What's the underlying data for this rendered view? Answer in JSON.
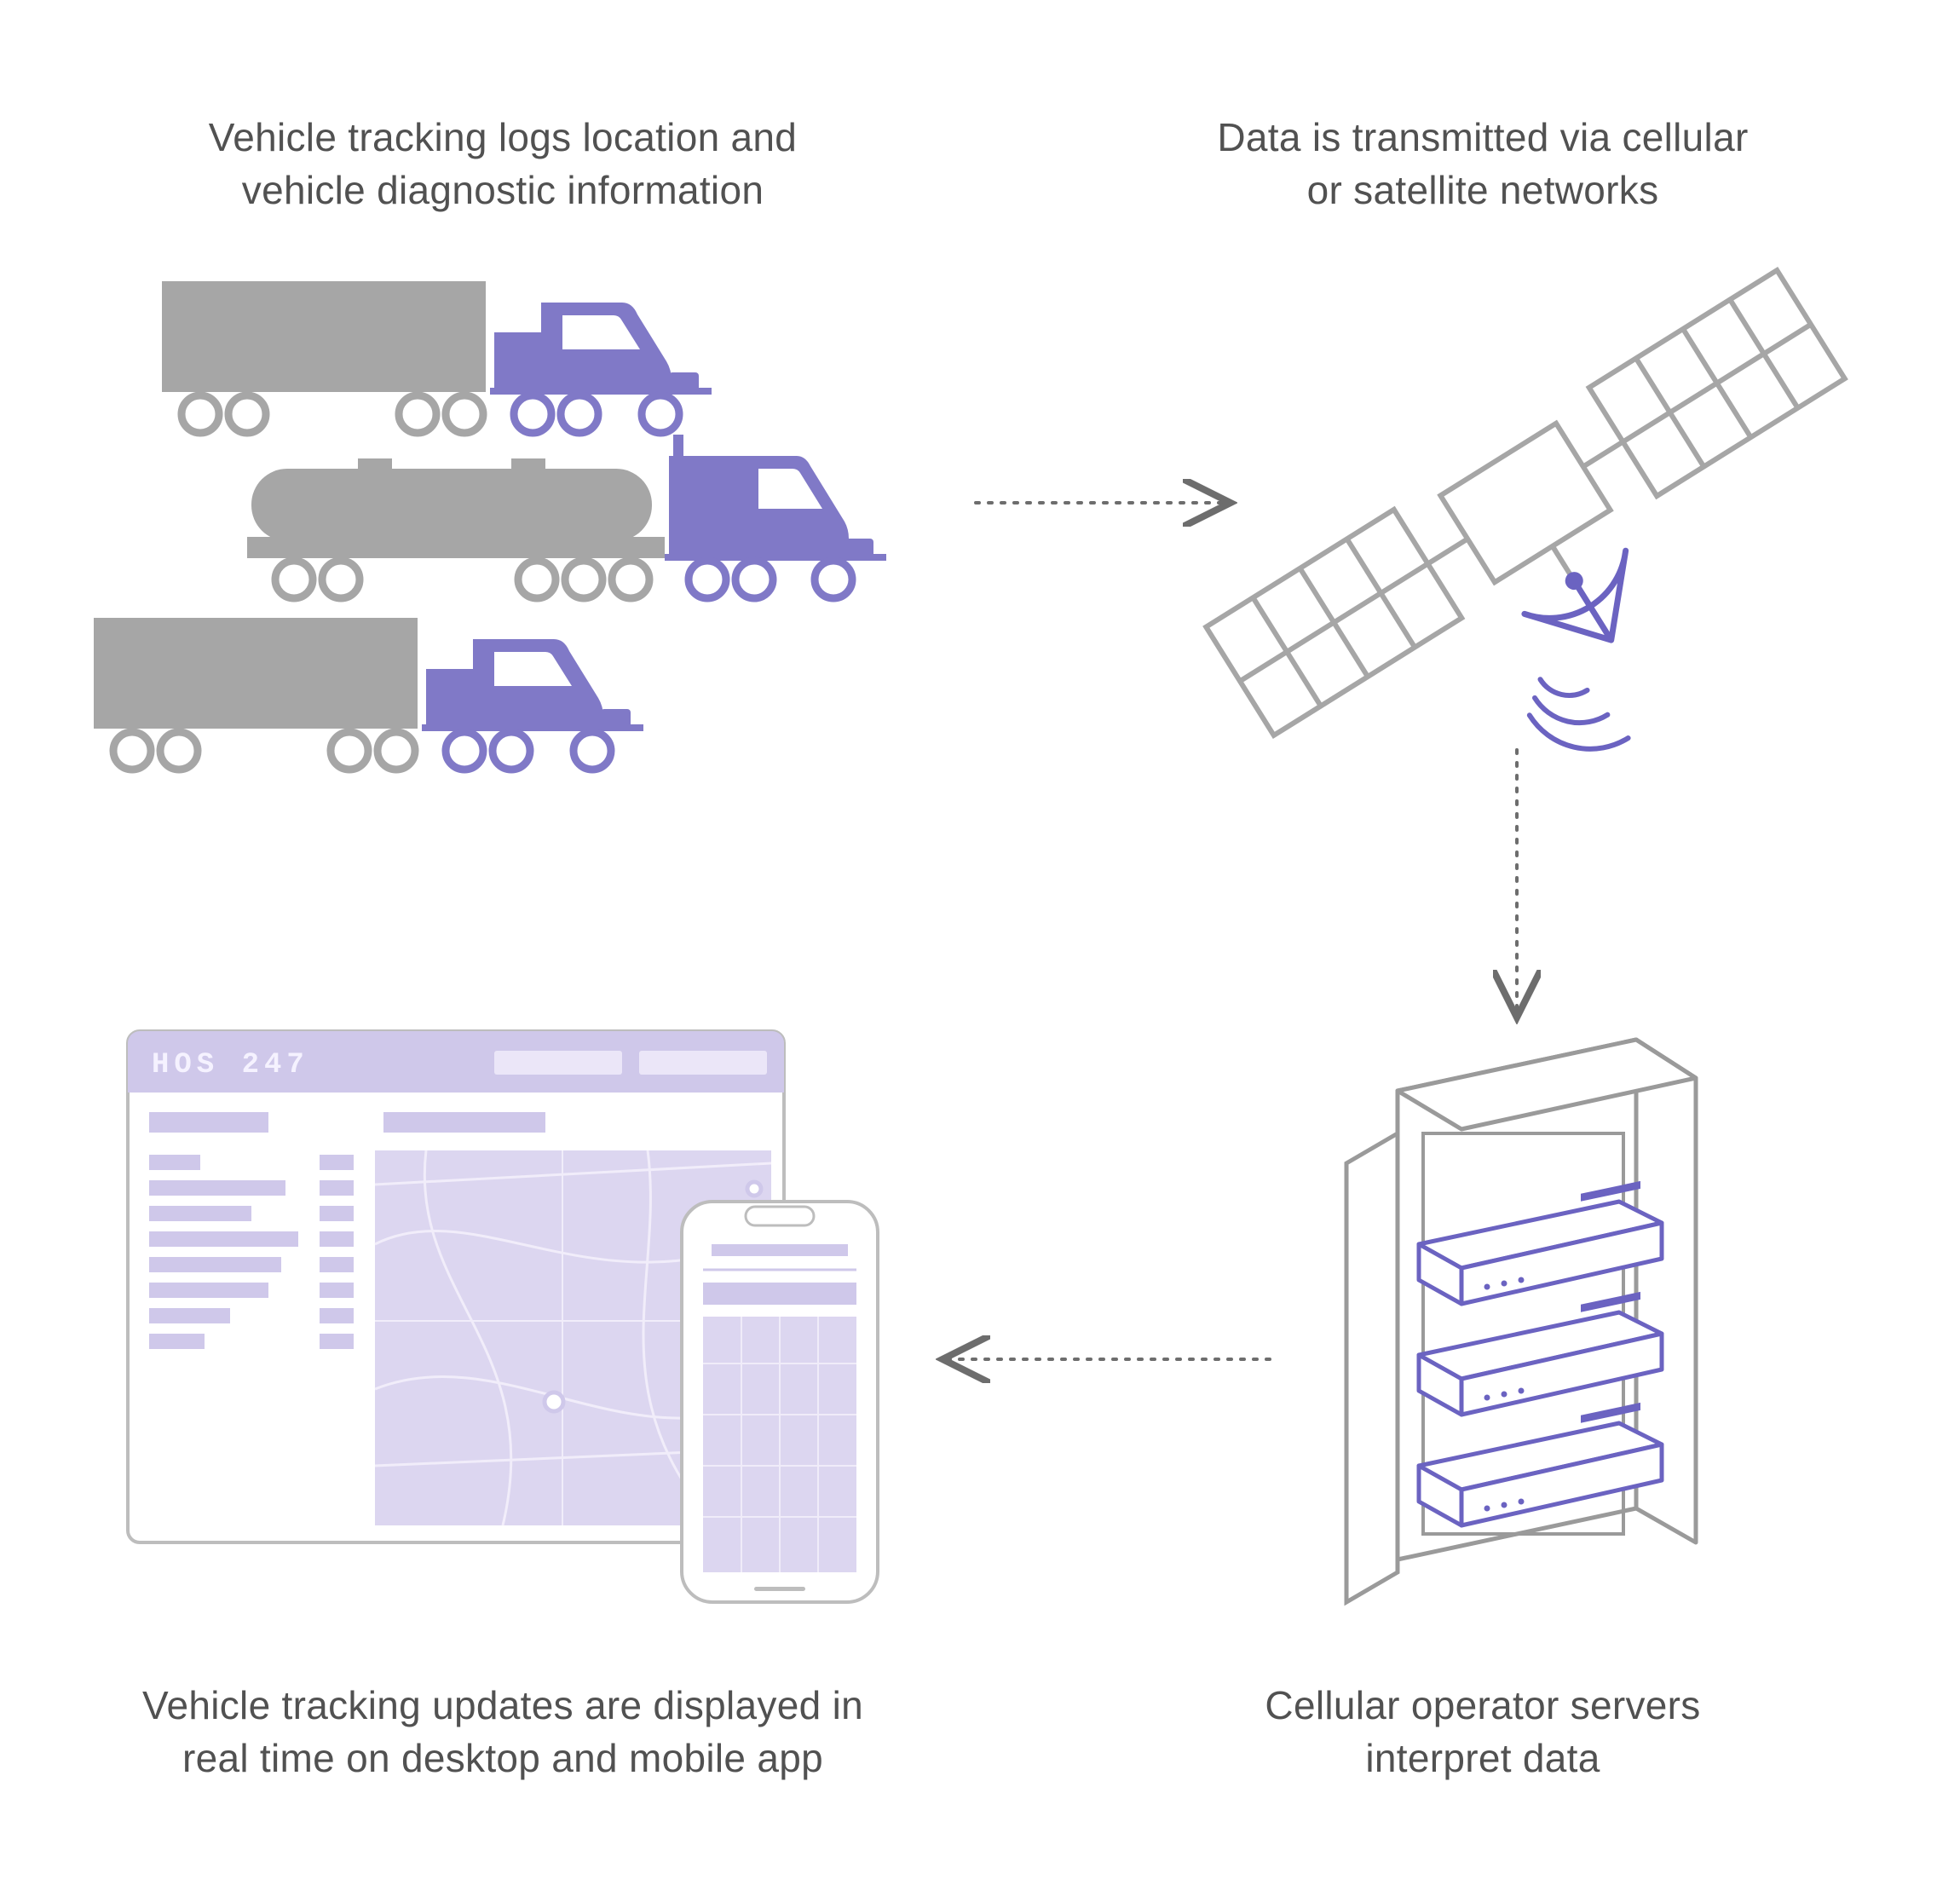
{
  "captions": {
    "vehicles": "Vehicle tracking logs location and\nvehicle diagnostic information",
    "satellite": "Data is transmitted via cellular\nor satellite networks",
    "server": "Cellular operator servers\ninterpret data",
    "dashboard": "Vehicle tracking updates are displayed in\nreal time on desktop and mobile app"
  },
  "dashboard": {
    "brand": "HOS 247"
  },
  "colors": {
    "purple": "#8079c7",
    "lightpurple": "#cfc8ea",
    "gray": "#a6a6a6"
  }
}
